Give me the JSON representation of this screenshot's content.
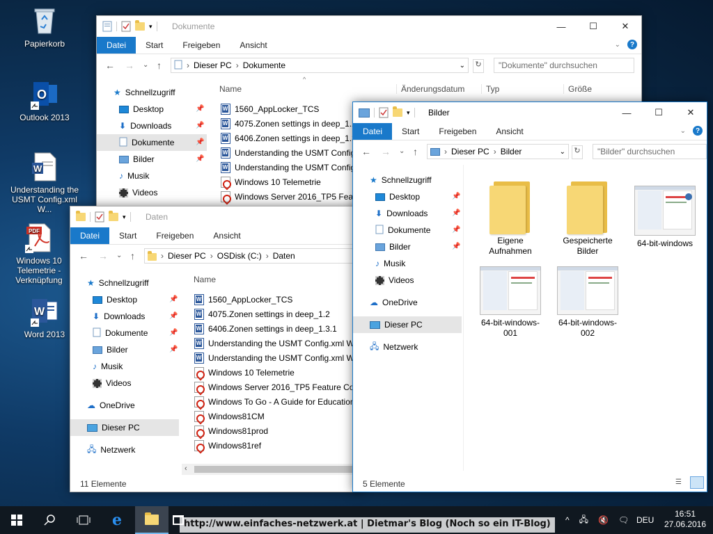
{
  "desktop": {
    "icons": [
      {
        "label": "Papierkorb",
        "icon": "recycle-bin-icon"
      },
      {
        "label": "Outlook 2013",
        "icon": "outlook-icon"
      },
      {
        "label": "Understanding the USMT Config.xml W...",
        "icon": "word-doc-icon"
      },
      {
        "label": "Windows 10 Telemetrie - Verknüpfung",
        "icon": "pdf-shortcut-icon"
      },
      {
        "label": "Word 2013",
        "icon": "word-icon"
      }
    ]
  },
  "win_dokumente": {
    "title": "Dokumente",
    "tabs": [
      "Datei",
      "Start",
      "Freigeben",
      "Ansicht"
    ],
    "address": [
      "Dieser PC",
      "Dokumente"
    ],
    "search_placeholder": "\"Dokumente\" durchsuchen",
    "nav": [
      "Schnellzugriff",
      "Desktop",
      "Downloads",
      "Dokumente",
      "Bilder",
      "Musik",
      "Videos"
    ],
    "columns": [
      "Name",
      "Änderungsdatum",
      "Typ",
      "Größe"
    ],
    "files": [
      {
        "name": "1560_AppLocker_TCS",
        "type": "word"
      },
      {
        "name": "4075.Zonen settings in deep_1.2",
        "type": "word"
      },
      {
        "name": "6406.Zonen settings in deep_1.3.1",
        "type": "word"
      },
      {
        "name": "Understanding the USMT Config.xml W",
        "type": "word"
      },
      {
        "name": "Understanding the USMT Config.xml W",
        "type": "word"
      },
      {
        "name": "Windows 10 Telemetrie",
        "type": "pdf"
      },
      {
        "name": "Windows Server 2016_TP5 Feature Com",
        "type": "pdf"
      }
    ]
  },
  "win_daten": {
    "title": "Daten",
    "tabs": [
      "Datei",
      "Start",
      "Freigeben",
      "Ansicht"
    ],
    "address": [
      "Dieser PC",
      "OSDisk (C:)",
      "Daten"
    ],
    "nav": [
      "Schnellzugriff",
      "Desktop",
      "Downloads",
      "Dokumente",
      "Bilder",
      "Musik",
      "Videos",
      "OneDrive",
      "Dieser PC",
      "Netzwerk"
    ],
    "column_name": "Name",
    "files": [
      {
        "name": "1560_AppLocker_TCS",
        "type": "word"
      },
      {
        "name": "4075.Zonen settings in deep_1.2",
        "type": "word"
      },
      {
        "name": "6406.Zonen settings in deep_1.3.1",
        "type": "word"
      },
      {
        "name": "Understanding the USMT Config.xml W",
        "type": "word"
      },
      {
        "name": "Understanding the USMT Config.xml W",
        "type": "word"
      },
      {
        "name": "Windows 10 Telemetrie",
        "type": "pdf"
      },
      {
        "name": "Windows Server 2016_TP5 Feature Com",
        "type": "pdf"
      },
      {
        "name": "Windows To Go - A Guide for Education",
        "type": "pdf"
      },
      {
        "name": "Windows81CM",
        "type": "pdf"
      },
      {
        "name": "Windows81prod",
        "type": "pdf"
      },
      {
        "name": "Windows81ref",
        "type": "pdf"
      }
    ],
    "status": "11 Elemente"
  },
  "win_bilder": {
    "title": "Bilder",
    "tabs": [
      "Datei",
      "Start",
      "Freigeben",
      "Ansicht"
    ],
    "address": [
      "Dieser PC",
      "Bilder"
    ],
    "search_placeholder": "\"Bilder\" durchsuchen",
    "nav": [
      "Schnellzugriff",
      "Desktop",
      "Downloads",
      "Dokumente",
      "Bilder",
      "Musik",
      "Videos",
      "OneDrive",
      "Dieser PC",
      "Netzwerk"
    ],
    "items": [
      {
        "label": "Eigene Aufnahmen",
        "kind": "folder"
      },
      {
        "label": "Gespeicherte Bilder",
        "kind": "folder"
      },
      {
        "label": "64-bit-windows",
        "kind": "image"
      },
      {
        "label": "64-bit-windows-001",
        "kind": "image"
      },
      {
        "label": "64-bit-windows-002",
        "kind": "image"
      }
    ],
    "status": "5 Elemente"
  },
  "taskbar": {
    "watermark": "http://www.einfaches-netzwerk.at | Dietmar's Blog (Noch so ein IT-Blog)",
    "language": "DEU",
    "time": "16:51",
    "date": "27.06.2016"
  },
  "colors": {
    "accent": "#1979ca",
    "selected": "#e5e5e5",
    "taskbar": "#101820"
  }
}
